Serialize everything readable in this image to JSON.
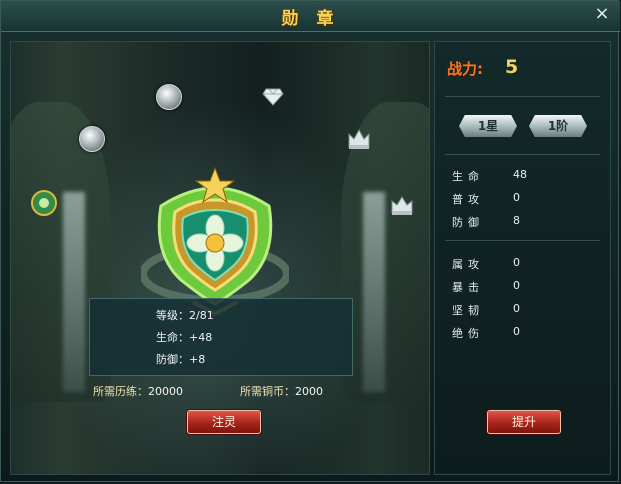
{
  "window": {
    "title": "勋 章",
    "close_symbol": "×"
  },
  "icons": {
    "slots": [
      "silver-wreath-medal-icon",
      "diamond-icon",
      "silver-wreath-medal-icon",
      "silver-crown-icon",
      "green-medal-icon",
      "silver-crown-icon"
    ],
    "main": "green-flower-shield-medal-icon"
  },
  "medal_info": {
    "level_label": "等级：",
    "level_value": "2/81",
    "hp_label": "生命：",
    "hp_value": "+48",
    "def_label": "防御：",
    "def_value": "+8"
  },
  "costs": {
    "exp_label": "所需历练：",
    "exp_value": "20000",
    "copper_label": "所需铜币：",
    "copper_value": "2000"
  },
  "buttons": {
    "infuse": "注灵",
    "upgrade": "提升"
  },
  "panel": {
    "power_label": "战力:",
    "power_value": "5",
    "badge_star": "1星",
    "badge_grade": "1阶",
    "base_stats": [
      {
        "label": "生命",
        "value": "48"
      },
      {
        "label": "普攻",
        "value": "0"
      },
      {
        "label": "防御",
        "value": "8"
      }
    ],
    "extra_stats": [
      {
        "label": "属攻",
        "value": "0"
      },
      {
        "label": "暴击",
        "value": "0"
      },
      {
        "label": "坚韧",
        "value": "0"
      },
      {
        "label": "绝伤",
        "value": "0"
      }
    ]
  },
  "colors": {
    "title": "#f5d35a",
    "power_label": "#f27a2a",
    "button_red": "#b52a20",
    "panel_bg": "#13292a"
  }
}
